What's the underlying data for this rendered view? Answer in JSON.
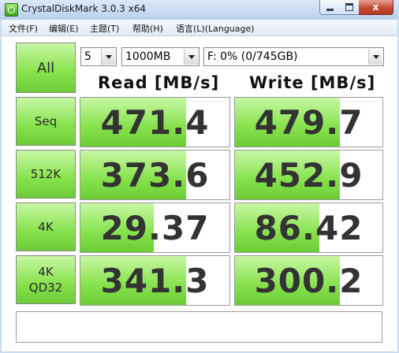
{
  "window": {
    "title": "CrystalDiskMark 3.0.3 x64",
    "close_glyph": "x",
    "accent_green": "#86e24c",
    "close_red": "#c44a33"
  },
  "menu": [
    {
      "label": "文件(F)"
    },
    {
      "label": "编辑(E)"
    },
    {
      "label": "主题(T)"
    },
    {
      "label": "帮助(H)"
    },
    {
      "label": "语言(L)(Language)"
    }
  ],
  "controls": {
    "all_label": "All",
    "count": "5",
    "size": "1000MB",
    "drive": "F: 0% (0/745GB)"
  },
  "headers": {
    "read": "Read [MB/s]",
    "write": "Write [MB/s]"
  },
  "rows": [
    {
      "label": "Seq",
      "label2": "",
      "read": "471.4",
      "write": "479.7",
      "read_fill": 0.71,
      "write_fill": 0.71
    },
    {
      "label": "512K",
      "label2": "",
      "read": "373.6",
      "write": "452.9",
      "read_fill": 0.71,
      "write_fill": 0.71
    },
    {
      "label": "4K",
      "label2": "",
      "read": "29.37",
      "write": "86.42",
      "read_fill": 0.49,
      "write_fill": 0.57
    },
    {
      "label": "4K",
      "label2": "QD32",
      "read": "341.3",
      "write": "300.2",
      "read_fill": 0.71,
      "write_fill": 0.71
    }
  ],
  "comment": ""
}
